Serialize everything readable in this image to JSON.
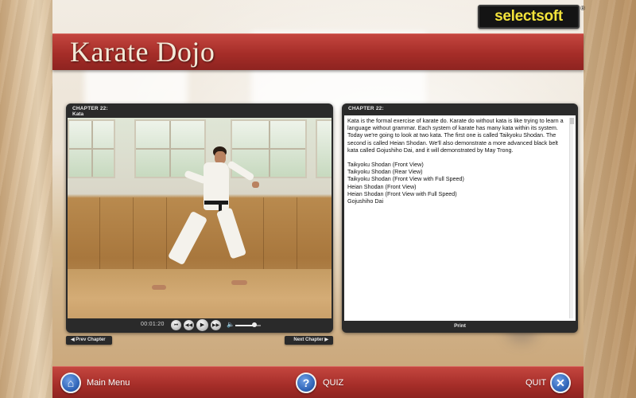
{
  "app": {
    "title": "Karate Dojo",
    "brand": "selectsoft",
    "brand_mark": "®"
  },
  "video_panel": {
    "chapter_label": "CHAPTER 22:",
    "chapter_title": "Kata",
    "timecode": "00:01:20",
    "volume_level": 0.75,
    "controls": {
      "rewind_icon": "skip-back-icon",
      "back_icon": "rewind-icon",
      "play_icon": "play-icon",
      "forward_icon": "fast-forward-icon",
      "volume_icon": "speaker-icon"
    }
  },
  "text_panel": {
    "chapter_label": "CHAPTER 22:",
    "description": "Kata is the formal exercise of karate do. Karate do without kata is like trying to learn a language without grammar. Each system of karate has many kata within its system. Today we're going to look at two kata. The first one is called Taikyoku Shodan. The second is called Heian Shodan. We'll also demonstrate a more advanced black belt kata called Gojushiho Dai, and it will demonstrated by May Trong.",
    "kata": [
      "Taikyoku Shodan (Front View)",
      "Taikyoku Shodan (Rear View)",
      "Taikyoku Shodan (Front View with Full Speed)",
      "Heian Shodan (Front View)",
      "Heian Shodan (Front View with Full Speed)",
      "Gojushiho Dai"
    ],
    "print_label": "Print"
  },
  "nav": {
    "prev_label": "◀ Prev Chapter",
    "next_label": "Next Chapter ▶"
  },
  "footer": {
    "main_menu_label": "Main Menu",
    "quiz_label": "QUIZ",
    "quit_label": "QUIT",
    "main_menu_icon": "home-icon",
    "quiz_icon": "question-icon",
    "quit_icon": "close-icon"
  },
  "colors": {
    "header_red": "#a52d28",
    "brand_yellow": "#f3e33b",
    "button_blue": "#2e63b6",
    "panel_dark": "#2a2a2a"
  }
}
